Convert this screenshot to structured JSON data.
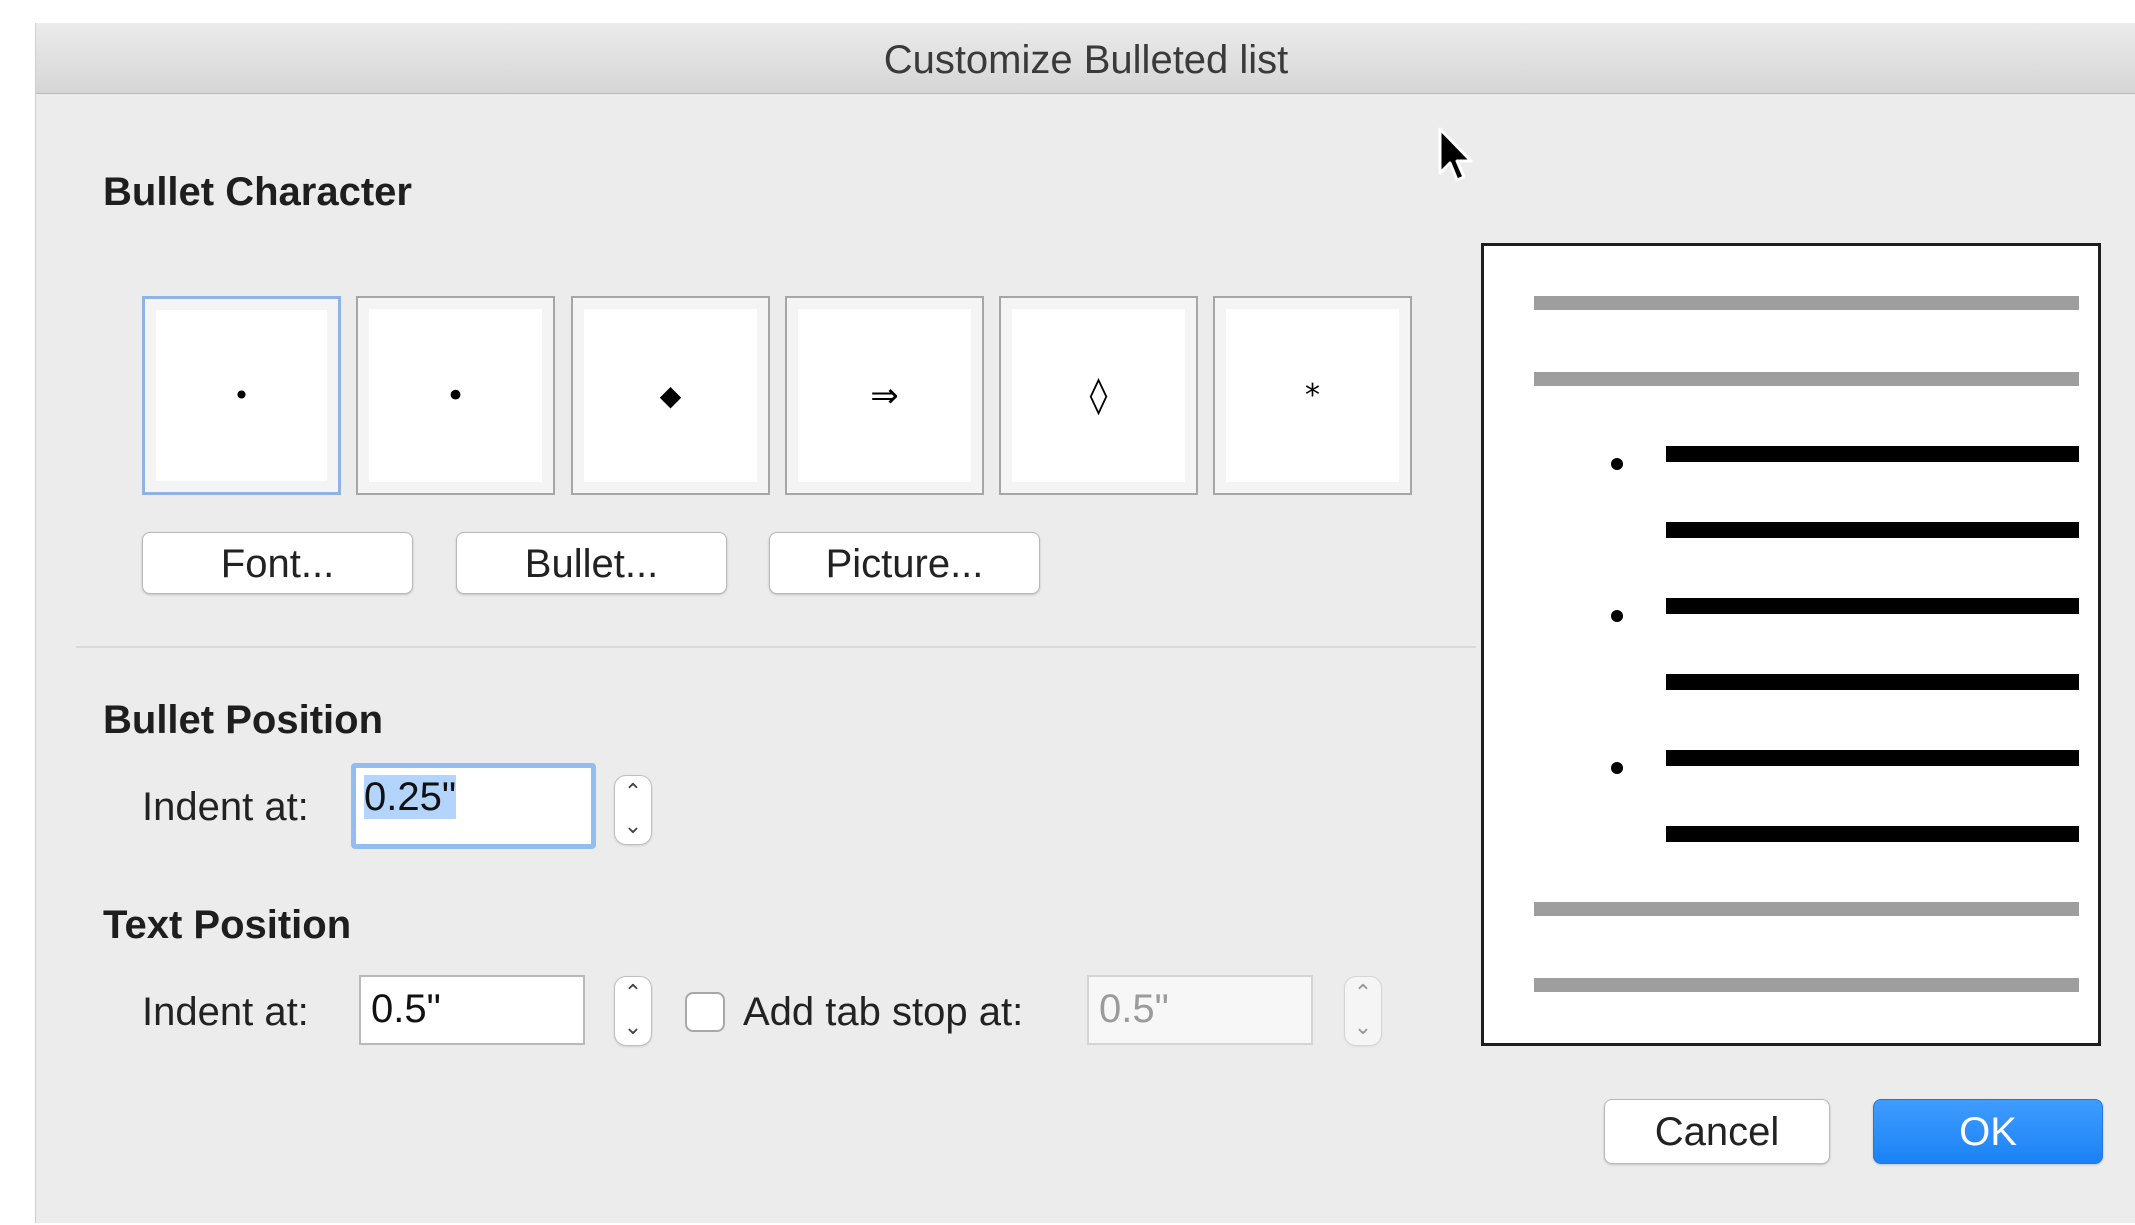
{
  "dialog": {
    "title": "Customize Bulleted list"
  },
  "bullet_character": {
    "heading": "Bullet Character",
    "swatches": [
      {
        "glyph": "•",
        "icon": "small-dot-bullet-icon",
        "selected": true
      },
      {
        "glyph": "•",
        "icon": "dot-bullet-icon",
        "selected": false
      },
      {
        "glyph": "◆",
        "icon": "diamond-bullet-icon",
        "selected": false
      },
      {
        "glyph": "⇒",
        "icon": "double-arrow-bullet-icon",
        "selected": false
      },
      {
        "glyph": "◊",
        "icon": "lozenge-bullet-icon",
        "selected": false
      },
      {
        "glyph": "*",
        "icon": "asterisk-bullet-icon",
        "selected": false
      }
    ],
    "buttons": {
      "font": "Font...",
      "bullet": "Bullet...",
      "picture": "Picture..."
    }
  },
  "bullet_position": {
    "heading": "Bullet Position",
    "indent_label": "Indent at:",
    "indent_value": "0.25\""
  },
  "text_position": {
    "heading": "Text Position",
    "indent_label": "Indent at:",
    "indent_value": "0.5\"",
    "tab_stop_label": "Add tab stop at:",
    "tab_stop_checked": false,
    "tab_stop_value": "0.5\""
  },
  "actions": {
    "cancel": "Cancel",
    "ok": "OK"
  },
  "colors": {
    "window_bg": "#ececec",
    "accent": "#1b82f5",
    "selection_highlight": "#b3d4fd",
    "preview_gray_line": "#9e9e9e"
  }
}
